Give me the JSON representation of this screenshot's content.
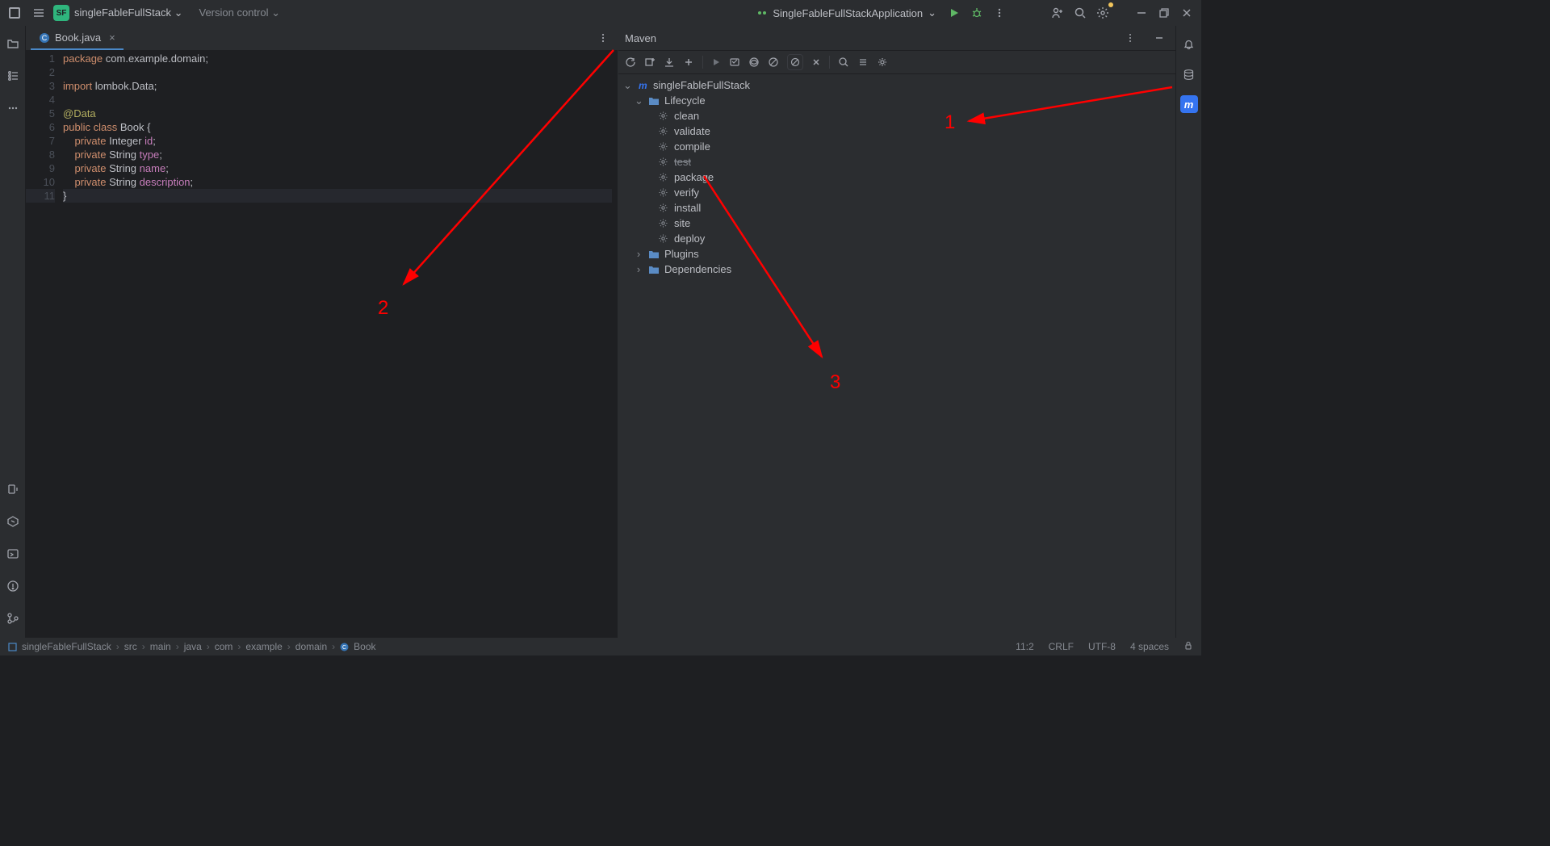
{
  "header": {
    "project_badge": "SF",
    "project_name": "singleFableFullStack",
    "vcs_label": "Version control",
    "run_config": "SingleFableFullStackApplication"
  },
  "editor": {
    "tab_file": "Book.java",
    "lines": [
      "1",
      "2",
      "3",
      "4",
      "5",
      "6",
      "7",
      "8",
      "9",
      "10",
      "11"
    ]
  },
  "code": {
    "l1_kw": "package",
    "l1_rest": " com.example.domain;",
    "l3_kw": "import",
    "l3_rest": " lombok.Data;",
    "l5": "@Data",
    "l6_a": "public class ",
    "l6_b": "Book ",
    "l6_c": "{",
    "l7_a": "    private ",
    "l7_b": "Integer ",
    "l7_c": "id",
    "l7_d": ";",
    "l8_a": "    private ",
    "l8_b": "String ",
    "l8_c": "type",
    "l8_d": ";",
    "l9_a": "    private ",
    "l9_b": "String ",
    "l9_c": "name",
    "l9_d": ";",
    "l10_a": "    private ",
    "l10_b": "String ",
    "l10_c": "description",
    "l10_d": ";",
    "l11": "}"
  },
  "maven": {
    "title": "Maven",
    "root": "singleFableFullStack",
    "groups": {
      "lifecycle": "Lifecycle",
      "plugins": "Plugins",
      "dependencies": "Dependencies"
    },
    "lifecycle": [
      "clean",
      "validate",
      "compile",
      "test",
      "package",
      "verify",
      "install",
      "site",
      "deploy"
    ],
    "struck": "test"
  },
  "breadcrumb": [
    "singleFableFullStack",
    "src",
    "main",
    "java",
    "com",
    "example",
    "domain",
    "Book"
  ],
  "status": {
    "pos": "11:2",
    "le": "CRLF",
    "enc": "UTF-8",
    "indent": "4 spaces"
  },
  "anno": {
    "n1": "1",
    "n2": "2",
    "n3": "3"
  },
  "right_rail": {
    "m": "m"
  }
}
